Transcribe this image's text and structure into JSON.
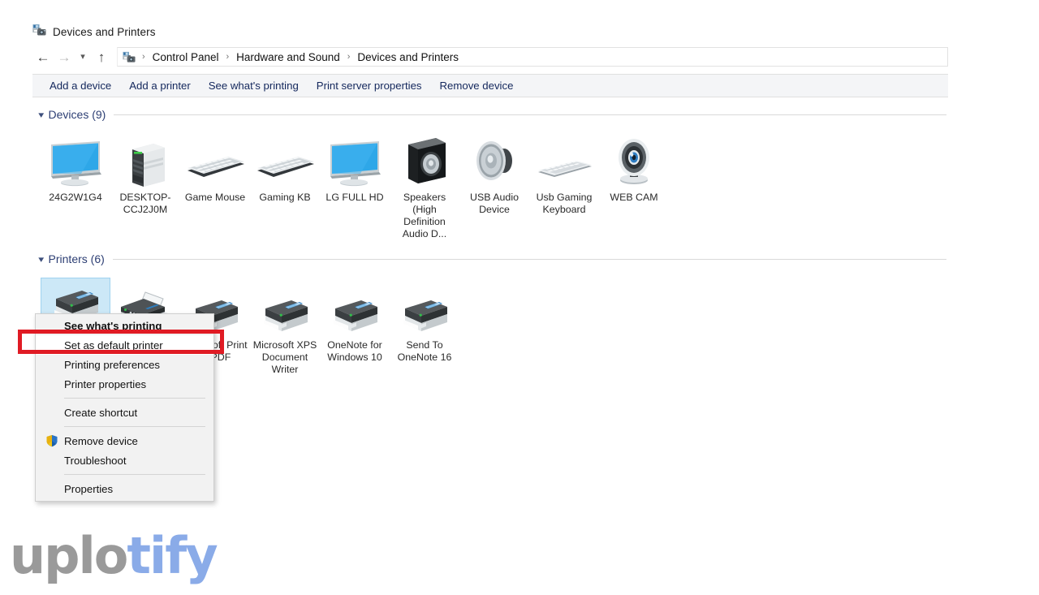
{
  "window": {
    "title": "Devices and Printers",
    "title_icon": "devices-and-printers-icon"
  },
  "address_bar": {
    "back_icon": "back-arrow-icon",
    "forward_icon": "forward-arrow-icon",
    "recent_icon": "chevron-down-icon",
    "up_icon": "up-arrow-icon",
    "path_icon": "devices-and-printers-icon",
    "crumbs": [
      "Control Panel",
      "Hardware and Sound",
      "Devices and Printers"
    ],
    "separator": "›"
  },
  "command_bar": {
    "items": [
      "Add a device",
      "Add a printer",
      "See what's printing",
      "Print server properties",
      "Remove device"
    ]
  },
  "groups": [
    {
      "title": "Devices (9)",
      "name": "devices",
      "collapse_icon": "chevron-down-icon",
      "items": [
        {
          "label": "24G2W1G4",
          "icon": "monitor-icon",
          "selected": false
        },
        {
          "label": "DESKTOP-CCJ2J0M",
          "icon": "desktop-tower-icon",
          "selected": false
        },
        {
          "label": "Game Mouse",
          "icon": "keyboard-icon",
          "selected": false
        },
        {
          "label": "Gaming KB",
          "icon": "keyboard-icon",
          "selected": false
        },
        {
          "label": "LG FULL HD",
          "icon": "monitor-icon",
          "selected": false
        },
        {
          "label": "Speakers (High Definition Audio D...",
          "icon": "speaker-box-icon",
          "selected": false
        },
        {
          "label": "USB Audio Device",
          "icon": "speaker-driver-icon",
          "selected": false
        },
        {
          "label": "Usb Gaming Keyboard",
          "icon": "keyboard-icon",
          "selected": false
        },
        {
          "label": "WEB CAM",
          "icon": "webcam-icon",
          "selected": false
        }
      ]
    },
    {
      "title": "Printers (6)",
      "name": "printers",
      "collapse_icon": "chevron-down-icon",
      "items": [
        {
          "label": "",
          "icon": "printer-icon",
          "selected": true
        },
        {
          "label": "",
          "icon": "fax-icon",
          "selected": false
        },
        {
          "label": "Microsoft Print to PDF",
          "icon": "printer-icon",
          "selected": false,
          "default_badge": true
        },
        {
          "label": "Microsoft XPS Document Writer",
          "icon": "printer-icon",
          "selected": false
        },
        {
          "label": "OneNote for Windows 10",
          "icon": "printer-icon",
          "selected": false
        },
        {
          "label": "Send To OneNote 16",
          "icon": "printer-icon",
          "selected": false
        }
      ]
    }
  ],
  "context_menu": {
    "items": [
      {
        "label": "See what's printing",
        "bold": true,
        "icon": null,
        "separator_after": false
      },
      {
        "label": "Set as default printer",
        "bold": false,
        "icon": null,
        "separator_after": false,
        "highlighted": true
      },
      {
        "label": "Printing preferences",
        "bold": false,
        "icon": null,
        "separator_after": false
      },
      {
        "label": "Printer properties",
        "bold": false,
        "icon": null,
        "separator_after": true
      },
      {
        "label": "Create shortcut",
        "bold": false,
        "icon": null,
        "separator_after": true
      },
      {
        "label": "Remove device",
        "bold": false,
        "icon": "uac-shield-icon",
        "separator_after": false
      },
      {
        "label": "Troubleshoot",
        "bold": false,
        "icon": null,
        "separator_after": true
      },
      {
        "label": "Properties",
        "bold": false,
        "icon": null,
        "separator_after": false
      }
    ]
  },
  "annotation": {
    "highlight_color": "#e01b24",
    "target_label": "Set as default printer"
  },
  "watermark": {
    "part1": "uplo",
    "part2": "tify",
    "color1": "#9a9a9a",
    "color2": "#8aabe8"
  }
}
